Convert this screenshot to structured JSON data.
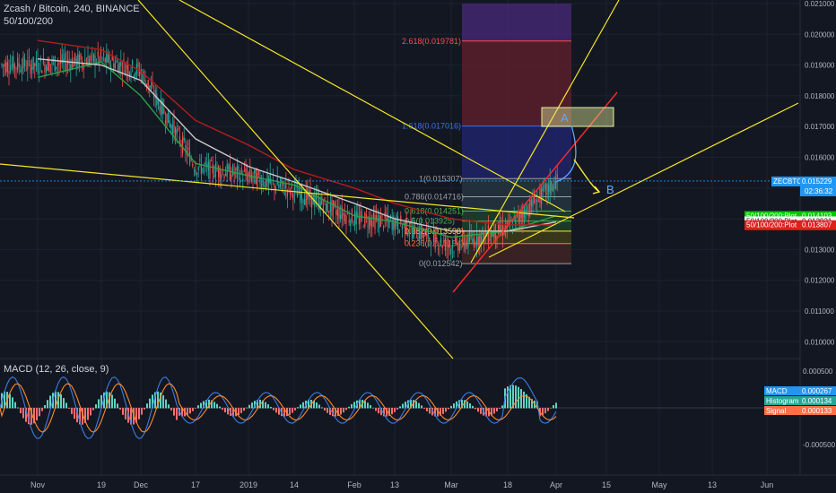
{
  "header": {
    "symbol_line": "Zcash / Bitcoin, 240, BINANCE",
    "indicator_line": "50/100/200"
  },
  "macd_header": {
    "label": "MACD (12, 26, close, 9)"
  },
  "colors": {
    "background": "#131722",
    "grid": "#1e2230",
    "candle_up": "#26a69a",
    "candle_down": "#ef5350",
    "ma50": "#2ea043",
    "ma100": "#c8c8c8",
    "ma200": "#b71c1c",
    "trend_yellow": "#f5e625",
    "trend_red": "#ff2a2a",
    "macd_line": "#3b7de0",
    "signal_line": "#ff8a2a",
    "hist_up": "#5fd3c0",
    "hist_down": "#ff6f6f"
  },
  "chart_data": {
    "type": "line",
    "title": "Zcash / Bitcoin, 240, BINANCE",
    "price_axis": {
      "ylim": [
        0.0094,
        0.021
      ],
      "ticks": [
        "0.021000",
        "0.020000",
        "0.019000",
        "0.018000",
        "0.017000",
        "0.016000",
        "0.015000",
        "0.014000",
        "0.013000",
        "0.012000",
        "0.011000",
        "0.010000"
      ],
      "tick_values": [
        0.021,
        0.02,
        0.019,
        0.018,
        0.017,
        0.016,
        0.015,
        0.014,
        0.013,
        0.012,
        0.011,
        0.01
      ]
    },
    "macd_axis": {
      "ticks": [
        "0.000500",
        "-0.000500"
      ],
      "tick_values": [
        0.0005,
        -0.0005
      ]
    },
    "x_ticks": [
      "Nov",
      "19",
      "Dec",
      "17",
      "2019",
      "14",
      "Feb",
      "13",
      "Mar",
      "18",
      "Apr",
      "15",
      "May",
      "13",
      "Jun"
    ],
    "series": [
      {
        "name": "",
        "kind": "price_close",
        "x": [
          "Nov",
          "19",
          "Dec",
          "17",
          "2019",
          "14",
          "Feb",
          "13",
          "Mar",
          "18",
          "Apr"
        ],
        "values": [
          0.019,
          0.0192,
          0.0188,
          0.0157,
          0.0154,
          0.0149,
          0.014,
          0.0139,
          0.0131,
          0.0137,
          0.0152
        ]
      },
      {
        "name": "",
        "kind": "ma50",
        "values": [
          0.0186,
          0.0191,
          0.018,
          0.0158,
          0.0154,
          0.0151,
          0.0141,
          0.0139,
          0.0134,
          0.0136,
          0.0141
        ]
      },
      {
        "name": "",
        "kind": "ma100",
        "values": [
          0.0192,
          0.019,
          0.0185,
          0.0166,
          0.0157,
          0.0152,
          0.0145,
          0.014,
          0.0136,
          0.0136,
          0.0139
        ]
      },
      {
        "name": "",
        "kind": "ma200",
        "values": [
          0.0198,
          0.0195,
          0.0188,
          0.0172,
          0.0164,
          0.0156,
          0.015,
          0.0145,
          0.014,
          0.0138,
          0.0138
        ]
      }
    ],
    "fibonacci": [
      {
        "level": "2.618",
        "price": "0.019781",
        "color": "#ff4b4b"
      },
      {
        "level": "1.618",
        "price": "0.017016",
        "color": "#3b6fe8"
      },
      {
        "level": "1",
        "price": "0.015307",
        "color": "#9aa0a6"
      },
      {
        "level": "0.786",
        "price": "0.014716",
        "color": "#9aa0a6"
      },
      {
        "level": "0.618",
        "price": "0.014251",
        "color": "#4caf50"
      },
      {
        "level": "0.5",
        "price": "0.013925",
        "color": "#4caf50"
      },
      {
        "level": "0.382",
        "price": "0.013598",
        "color": "#ffeb3b"
      },
      {
        "level": "0.236",
        "price": "0.013194",
        "color": "#ff7043"
      },
      {
        "level": "0",
        "price": "0.012542",
        "color": "#9aa0a6"
      }
    ],
    "annotations": [
      "A",
      "B"
    ],
    "price_tags": [
      {
        "label": "ZECBTC",
        "value": "0.015229",
        "sub": "02:36:32",
        "color": "#2196f3",
        "price": 0.015229
      },
      {
        "label": "50/100/200:Plot",
        "value": "0.014103",
        "color": "#00c800",
        "price": 0.014103
      },
      {
        "label": "50/100/200:Plot",
        "value": "0.013931",
        "color": "#ffffff",
        "price": 0.013931
      },
      {
        "label": "50/100/200:Plot",
        "value": "0.013807",
        "color": "#e0201b",
        "price": 0.013807
      }
    ],
    "macd_tags": [
      {
        "label": "MACD",
        "value": "0.000267",
        "color": "#2196f3"
      },
      {
        "label": "Histogram",
        "value": "0.000134",
        "color": "#26a69a"
      },
      {
        "label": "Signal",
        "value": "0.000133",
        "color": "#ff7043"
      }
    ],
    "legend": "none"
  }
}
